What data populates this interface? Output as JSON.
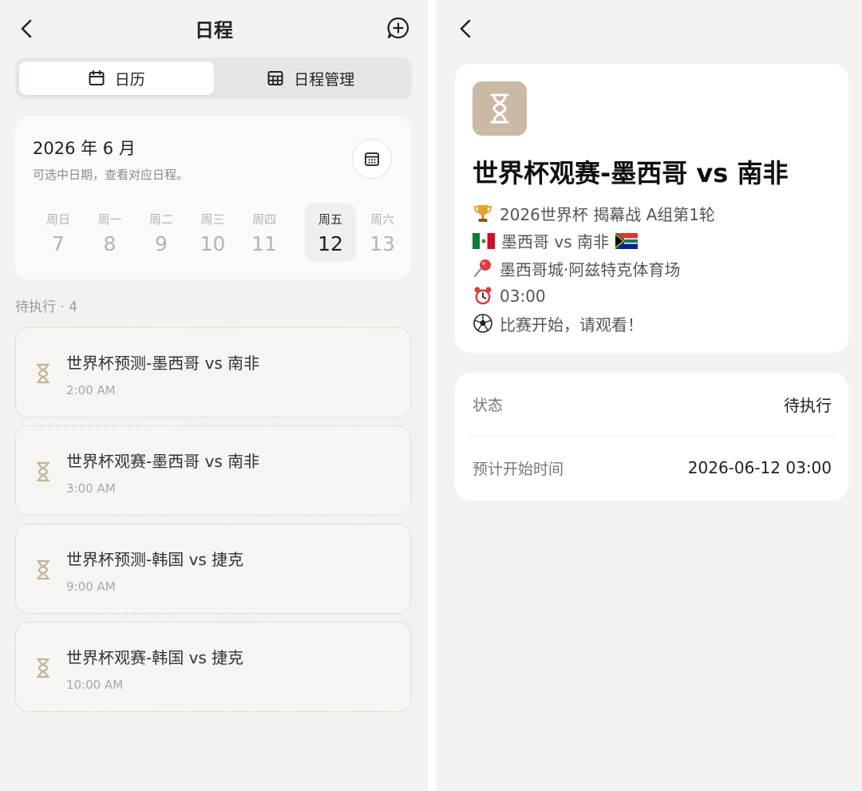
{
  "left_screen": {
    "header": {
      "title": "日程"
    },
    "tabs": [
      {
        "label": "日历",
        "icon": "calendar-icon",
        "active": true
      },
      {
        "label": "日程管理",
        "icon": "grid-icon",
        "active": false
      }
    ],
    "calendar": {
      "month_label": "2026 年 6 月",
      "hint": "可选中日期，查看对应日程。",
      "days": [
        {
          "name": "周日",
          "num": "7"
        },
        {
          "name": "周一",
          "num": "8"
        },
        {
          "name": "周二",
          "num": "9"
        },
        {
          "name": "周三",
          "num": "10"
        },
        {
          "name": "周四",
          "num": "11"
        },
        {
          "name": "周五",
          "num": "12",
          "selected": true
        },
        {
          "name": "周六",
          "num": "13"
        }
      ]
    },
    "pending": {
      "label": "待执行 · 4",
      "items": [
        {
          "title": "世界杯预测-墨西哥 vs 南非",
          "time": "2:00 AM"
        },
        {
          "title": "世界杯观赛-墨西哥 vs 南非",
          "time": "3:00 AM"
        },
        {
          "title": "世界杯预测-韩国 vs 捷克",
          "time": "9:00 AM"
        },
        {
          "title": "世界杯观赛-韩国 vs 捷克",
          "time": "10:00 AM"
        }
      ]
    }
  },
  "right_screen": {
    "detail": {
      "title": "世界杯观赛-墨西哥 vs 南非",
      "lines": [
        {
          "icon": "trophy-icon",
          "text": "2026世界杯 揭幕战 A组第1轮"
        },
        {
          "icon": "mexico-flag-icon",
          "text": "墨西哥 vs 南非",
          "trailing_icon": "south-africa-flag-icon"
        },
        {
          "icon": "pushpin-icon",
          "text": "墨西哥城·阿兹特克体育场"
        },
        {
          "icon": "alarm-clock-icon",
          "text": "03:00"
        },
        {
          "icon": "soccer-ball-icon",
          "text": "比赛开始，请观看！"
        }
      ]
    },
    "status": {
      "rows": [
        {
          "key": "状态",
          "value": "待执行"
        },
        {
          "key": "预计开始时间",
          "value": "2026-06-12 03:00"
        }
      ]
    }
  },
  "colors": {
    "background": "#f2f2f0",
    "card": "#ffffff",
    "accent_tan": "#c9b9a5",
    "hourglass": "#c2b49a"
  }
}
